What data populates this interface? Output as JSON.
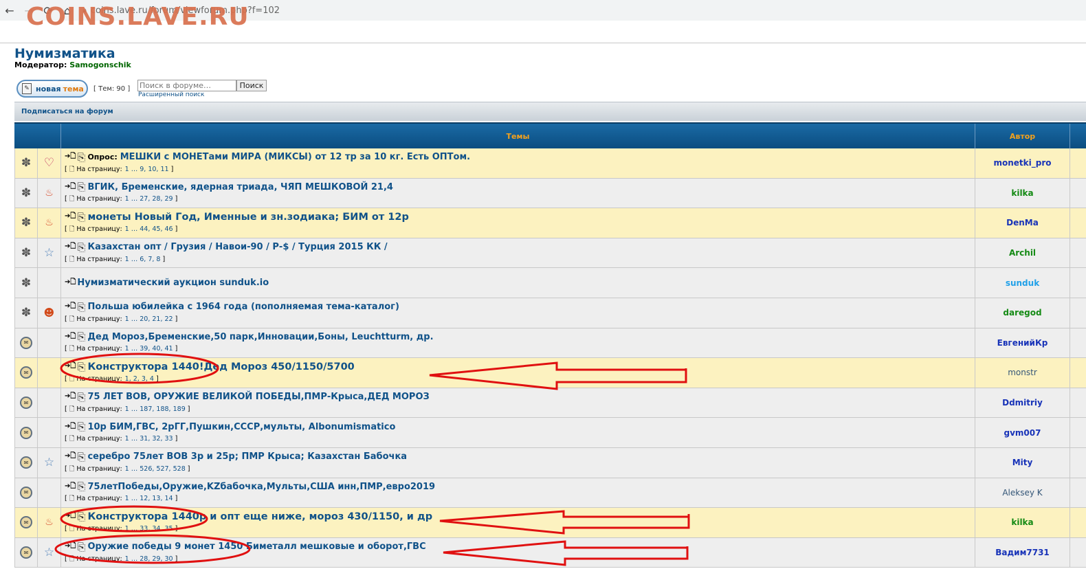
{
  "browser": {
    "url": "coins.lave.ru/forum/viewforum.php?f=102",
    "back_icon": "back-arrow-icon",
    "reload_icon": "reload-icon",
    "home_icon": "home-icon"
  },
  "watermark": "COINS.LAVE.RU",
  "forum": {
    "title": "Нумизматика",
    "moderator_label": "Модератор:",
    "moderator_name": "Samogonschik",
    "new_topic_label_1": "новая",
    "new_topic_label_2": "тема",
    "topic_count": "[ Тем: 90 ]",
    "search_placeholder": "Поиск в форуме…",
    "search_button": "Поиск",
    "advanced_search": "Расширенный поиск",
    "subscribe": "Подписаться на форум"
  },
  "table": {
    "headers": {
      "topics": "Темы",
      "author": "Автор"
    },
    "pages_label": "На страницу:",
    "rows": [
      {
        "poll": "Опрос:",
        "title": "МЕШКИ с МОНЕТами МИРА (МИКСЫ) от 12 тр за 10 кг. Есть ОПТом.",
        "pages": "1 … 9, 10, 11",
        "author": "monetki_pro",
        "author_color": "#1833b8",
        "icon1": "sticky-icon",
        "icon2": "heart-icon",
        "bg": "yellow"
      },
      {
        "poll": "",
        "title": "ВГИК, Бременские, ядерная триада, ЧЯП МЕШКОВОЙ 21,4",
        "pages": "1 … 27, 28, 29",
        "author": "kilka",
        "author_color": "#148a14",
        "icon1": "sticky-icon",
        "icon2": "fire-icon",
        "bg": "grey"
      },
      {
        "poll": "",
        "title": "монеты Новый Год, Именные и зн.зодиака; БИМ от 12р",
        "pages": "1 … 44, 45, 46",
        "author": "DenMa",
        "author_color": "#1833b8",
        "icon1": "sticky-icon",
        "icon2": "fire-icon",
        "bg": "yellow",
        "big": true
      },
      {
        "poll": "",
        "title": "Казахстан опт / Грузия / Навои-90 / Р-$ / Турция 2015 КК /",
        "pages": "1 … 6, 7, 8",
        "author": "Archil",
        "author_color": "#148a14",
        "icon1": "sticky-icon",
        "icon2": "star-icon",
        "bg": "grey"
      },
      {
        "poll": "",
        "title": "Нумизматический аукцион sunduk.io",
        "pages": "",
        "author": "sunduk",
        "author_color": "#20a0e8",
        "icon1": "sticky-icon",
        "icon2": "",
        "bg": "grey"
      },
      {
        "poll": "",
        "title": "Польша юбилейка с 1964 года (пополняемая тема-каталог)",
        "pages": "1 … 20, 21, 22",
        "author": "daregod",
        "author_color": "#148a14",
        "icon1": "sticky-icon",
        "icon2": "face-icon",
        "bg": "grey"
      },
      {
        "poll": "",
        "title": "Дед Мороз,Бременские,50 парк,Инновации,Боны, Leuchtturm, др.",
        "pages": "1 … 39, 40, 41",
        "author": "ЕвгенийКр",
        "author_color": "#1833b8",
        "icon1": "topic-icon",
        "icon2": "",
        "bg": "grey"
      },
      {
        "poll": "",
        "title": "Конструктора 1440!Дед Мороз 450/1150/5700",
        "pages": "1, 2, 3, 4",
        "author": "monstr",
        "author_color": "#335577",
        "icon1": "topic-icon",
        "icon2": "",
        "bg": "yellow",
        "big": true,
        "plain": true
      },
      {
        "poll": "",
        "title": "75 ЛЕТ ВОВ, ОРУЖИЕ ВЕЛИКОЙ ПОБЕДЫ,ПМР-Крыса,ДЕД МОРОЗ",
        "pages": "1 … 187, 188, 189",
        "author": "Ddmitriy",
        "author_color": "#1833b8",
        "icon1": "topic-icon",
        "icon2": "",
        "bg": "grey"
      },
      {
        "poll": "",
        "title": "10р БИМ,ГВС, 2рГГ,Пушкин,СССР,мульты, Albonumismatico",
        "pages": "1 … 31, 32, 33",
        "author": "gvm007",
        "author_color": "#1833b8",
        "icon1": "topic-icon",
        "icon2": "",
        "bg": "grey"
      },
      {
        "poll": "",
        "title": "серебро 75лет ВОВ 3р и 25р; ПМР Крыса; Казахстан Бабочка",
        "pages": "1 … 526, 527, 528",
        "author": "Mity",
        "author_color": "#1833b8",
        "icon1": "topic-hot-icon",
        "icon2": "star-icon",
        "bg": "grey"
      },
      {
        "poll": "",
        "title": "75летПобеды,Оружие,KZбабочка,Мульты,США инн,ПМР,евро2019",
        "pages": "1 … 12, 13, 14",
        "author": "Aleksey K",
        "author_color": "#335577",
        "icon1": "topic-icon",
        "icon2": "",
        "bg": "grey",
        "plain": true
      },
      {
        "poll": "",
        "title": "Конструктора 1440р и опт еще ниже, мороз 430/1150, и др",
        "pages": "1 … 33, 34, 35",
        "author": "kilka",
        "author_color": "#148a14",
        "icon1": "topic-icon",
        "icon2": "fire-icon",
        "bg": "yellow",
        "big": true
      },
      {
        "poll": "",
        "title": "Оружие победы 9 монет 1450 Биметалл мешковые и оборот,ГВС",
        "pages": "1 … 28, 29, 30",
        "author": "Вадим7731",
        "author_color": "#1833b8",
        "icon1": "topic-hot-icon",
        "icon2": "star-icon",
        "bg": "grey"
      }
    ]
  }
}
